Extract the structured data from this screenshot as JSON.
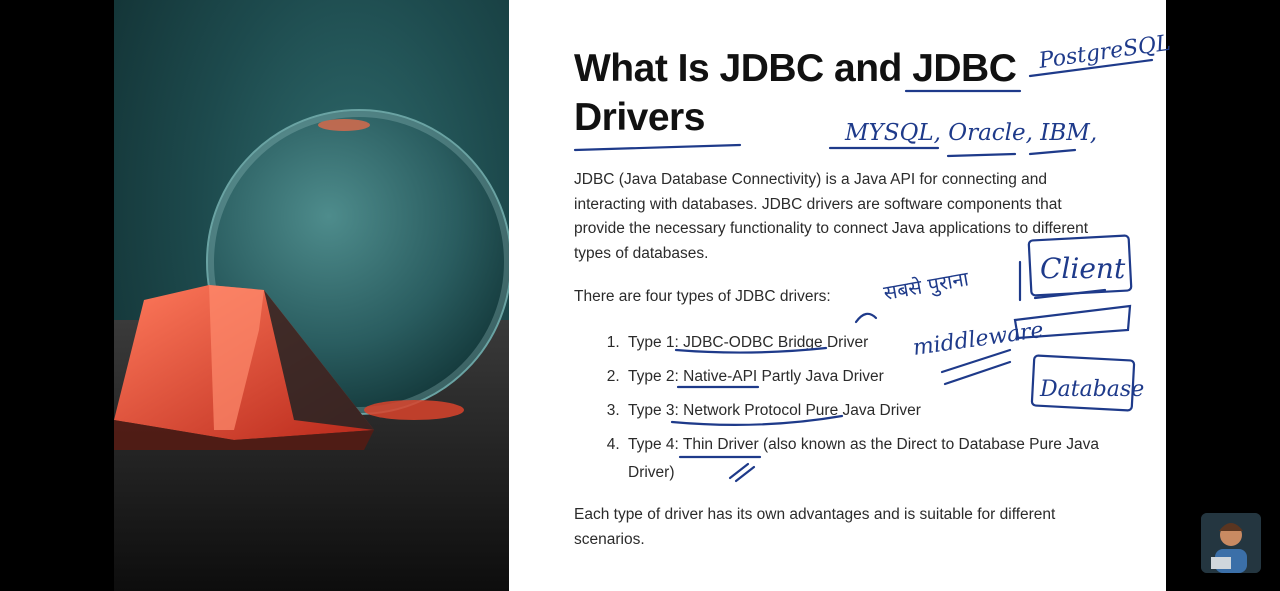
{
  "slide": {
    "title": "What Is JDBC and JDBC Drivers",
    "intro": "JDBC (Java Database Connectivity) is a Java API for connecting and interacting with databases. JDBC drivers are software components that provide the necessary functionality to connect Java applications to different types of databases.",
    "types_intro": "There are four types of JDBC drivers:",
    "driver_types": [
      "Type 1: JDBC-ODBC Bridge Driver",
      "Type 2: Native-API Partly Java Driver",
      "Type 3: Network Protocol Pure Java Driver",
      "Type 4: Thin Driver (also known as the Direct to Database Pure Java Driver)"
    ],
    "conclusion": "Each type of driver has its own advantages and is suitable for different scenarios."
  },
  "annotations": {
    "postgres": "PostgreSQL",
    "databases": "MYSQL, Oracle, IBM,",
    "oldest": "सबसे पुराना",
    "client": "Client",
    "middleware": "middleware",
    "database": "Database"
  },
  "colors": {
    "ink": "#1e3a8a",
    "title": "#111111",
    "body": "#2b2b2b",
    "prism": "#e2452d"
  }
}
